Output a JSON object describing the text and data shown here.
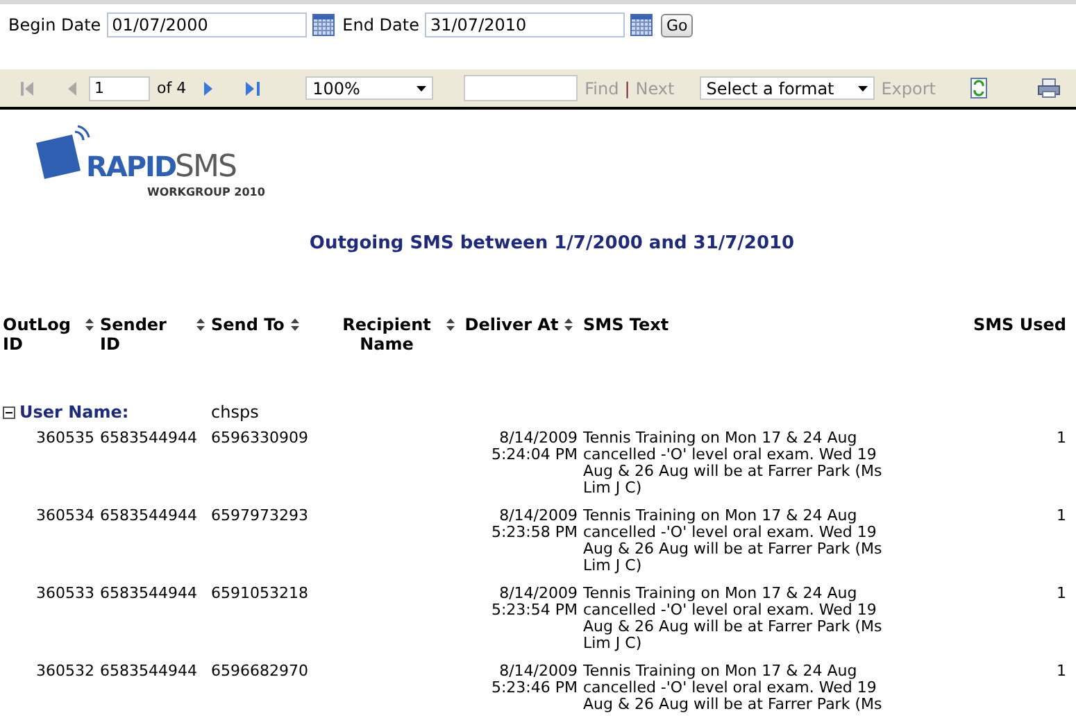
{
  "params": {
    "begin_label": "Begin Date",
    "begin_value": "01/07/2000",
    "end_label": "End Date",
    "end_value": "31/07/2010",
    "go": "Go"
  },
  "toolbar": {
    "page": "1",
    "of": "of 4",
    "zoom": "100%",
    "find": "Find",
    "separator": "|",
    "next": "Next",
    "format": "Select a format",
    "export": "Export"
  },
  "logo": {
    "brand_first": "RAPID",
    "brand_second": "SMS",
    "subtitle": "WORKGROUP 2010"
  },
  "report_title": "Outgoing SMS between 1/7/2000 and 31/7/2010",
  "columns": [
    {
      "label": "OutLog ID",
      "sortable": true
    },
    {
      "label": "Sender ID",
      "sortable": true
    },
    {
      "label": "Send To",
      "sortable": true
    },
    {
      "label": "Recipient Name",
      "sortable": true
    },
    {
      "label": "Deliver At",
      "sortable": true
    },
    {
      "label": "SMS Text",
      "sortable": false
    },
    {
      "label": "SMS Used",
      "sortable": false
    }
  ],
  "group": {
    "label": "User Name:",
    "value": "chsps",
    "expanded": true
  },
  "rows": [
    {
      "outlog_id": "360535",
      "sender_id": "6583544944",
      "send_to": "6596330909",
      "deliver_date": "8/14/2009",
      "deliver_time": "5:24:04 PM",
      "sms_text_lines": [
        "Tennis Training on Mon 17 & 24 Aug",
        "cancelled -'O' level oral exam. Wed 19",
        "Aug & 26 Aug will be at Farrer Park (Ms",
        "Lim J C)"
      ],
      "sms_used": "1"
    },
    {
      "outlog_id": "360534",
      "sender_id": "6583544944",
      "send_to": "6597973293",
      "deliver_date": "8/14/2009",
      "deliver_time": "5:23:58 PM",
      "sms_text_lines": [
        "Tennis Training on Mon 17 & 24 Aug",
        "cancelled -'O' level oral exam. Wed 19",
        "Aug & 26 Aug will be at Farrer Park (Ms",
        "Lim J C)"
      ],
      "sms_used": "1"
    },
    {
      "outlog_id": "360533",
      "sender_id": "6583544944",
      "send_to": "6591053218",
      "deliver_date": "8/14/2009",
      "deliver_time": "5:23:54 PM",
      "sms_text_lines": [
        "Tennis Training on Mon 17 & 24 Aug",
        "cancelled -'O' level oral exam. Wed 19",
        "Aug & 26 Aug will be at Farrer Park (Ms",
        "Lim J C)"
      ],
      "sms_used": "1"
    },
    {
      "outlog_id": "360532",
      "sender_id": "6583544944",
      "send_to": "6596682970",
      "deliver_date": "8/14/2009",
      "deliver_time": "5:23:46 PM",
      "sms_text_lines": [
        "Tennis Training on Mon 17 & 24 Aug",
        "cancelled -'O' level oral exam. Wed 19",
        "Aug & 26 Aug will be at Farrer Park (Ms"
      ],
      "sms_used": "1"
    }
  ]
}
